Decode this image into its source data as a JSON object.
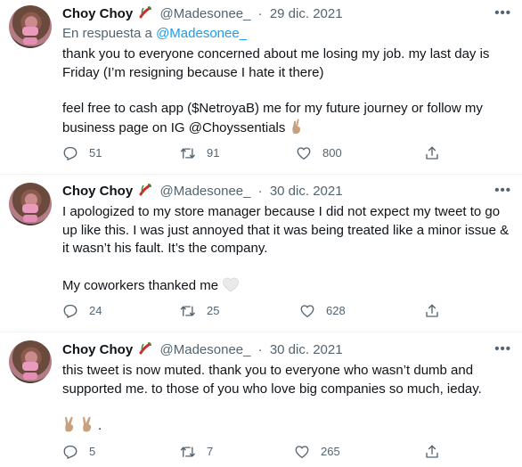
{
  "tweets": [
    {
      "author": "Choy Choy",
      "handle": "@Madesonee_",
      "date": "29 dic. 2021",
      "reply_prefix": "En respuesta a",
      "reply_to": "@Madesonee_",
      "paragraphs": [
        "thank you to everyone concerned about me losing my job. my last day is Friday (I’m resigning because I hate it there)",
        "feel free to cash app ($NetroyaB) me for my future journey or follow my business page on IG @Choyssentials"
      ],
      "replies": "51",
      "retweets": "91",
      "likes": "800"
    },
    {
      "author": "Choy Choy",
      "handle": "@Madesonee_",
      "date": "30 dic. 2021",
      "paragraphs": [
        "I apologized to my store manager because I did not expect my tweet to go up like this. I was just annoyed that it was being treated like a minor issue & it wasn’t his fault. It’s the company.",
        "My coworkers thanked me"
      ],
      "replies": "24",
      "retweets": "25",
      "likes": "628"
    },
    {
      "author": "Choy Choy",
      "handle": "@Madesonee_",
      "date": "30 dic. 2021",
      "paragraphs": [
        "this tweet is now muted. thank you to everyone who wasn’t dumb and supported me. to those of you who love big companies so much, ieday.",
        "."
      ],
      "replies": "5",
      "retweets": "7",
      "likes": "265"
    }
  ],
  "icons": {
    "more": "more-icon",
    "reply": "reply-icon",
    "retweet": "retweet-icon",
    "like": "like-icon",
    "share": "share-icon"
  },
  "colors": {
    "text": "#0f1419",
    "secondary": "#536471",
    "link": "#1d9bf0",
    "divider": "#eff3f4"
  },
  "more_label": "•••",
  "separator": "·"
}
